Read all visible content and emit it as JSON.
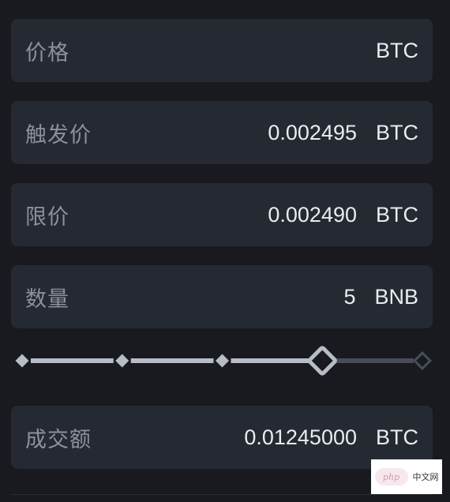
{
  "form": {
    "price": {
      "label": "价格",
      "value": "",
      "unit": "BTC"
    },
    "trigger_price": {
      "label": "触发价",
      "value": "0.002495",
      "unit": "BTC"
    },
    "limit_price": {
      "label": "限价",
      "value": "0.002490",
      "unit": "BTC"
    },
    "quantity": {
      "label": "数量",
      "value": "5",
      "unit": "BNB"
    },
    "total": {
      "label": "成交额",
      "value": "0.01245000",
      "unit": "BTC"
    }
  },
  "slider": {
    "level_percent": 75,
    "steps_percent": [
      0,
      25,
      50,
      75,
      100
    ]
  },
  "watermark": {
    "logo_text": "php",
    "site_text": "中文网"
  },
  "colors": {
    "background": "#181a20",
    "field_bg": "#252932",
    "label": "#8c919b",
    "value": "#eaecef",
    "slider_active": "#b7bdc6",
    "slider_inactive": "#474d57"
  }
}
